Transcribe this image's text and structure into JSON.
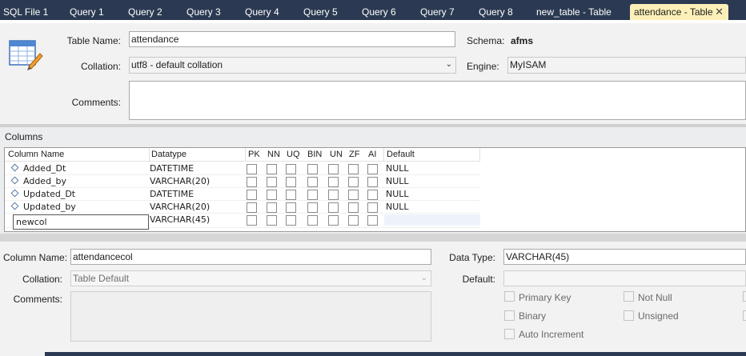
{
  "tabs": [
    {
      "label": "SQL File 1",
      "active": false
    },
    {
      "label": "Query 1",
      "active": false
    },
    {
      "label": "Query 2",
      "active": false
    },
    {
      "label": "Query 3",
      "active": false
    },
    {
      "label": "Query 4",
      "active": false
    },
    {
      "label": "Query 5",
      "active": false
    },
    {
      "label": "Query 6",
      "active": false
    },
    {
      "label": "Query 7",
      "active": false
    },
    {
      "label": "Query 8",
      "active": false
    },
    {
      "label": "new_table - Table",
      "active": false
    },
    {
      "label": "attendance - Table",
      "active": true
    }
  ],
  "close_glyph": "✕",
  "table": {
    "name_label": "Table Name:",
    "name_value": "attendance",
    "schema_label": "Schema:",
    "schema_value": "afms",
    "collation_label": "Collation:",
    "collation_value": "utf8 - default collation",
    "engine_label": "Engine:",
    "engine_value": "MyISAM",
    "comments_label": "Comments:",
    "comments_value": ""
  },
  "columns_section": {
    "title": "Columns",
    "headers": [
      "Column Name",
      "Datatype",
      "PK",
      "NN",
      "UQ",
      "BIN",
      "UN",
      "ZF",
      "AI",
      "Default"
    ],
    "rows": [
      {
        "name": "Added_Dt",
        "datatype": "DATETIME",
        "default": "NULL"
      },
      {
        "name": "Added_by",
        "datatype": "VARCHAR(20)",
        "default": "NULL"
      },
      {
        "name": "Updated_Dt",
        "datatype": "DATETIME",
        "default": "NULL"
      },
      {
        "name": "Updated_by",
        "datatype": "VARCHAR(20)",
        "default": "NULL"
      }
    ],
    "new_row": {
      "name": "newcol",
      "datatype": "VARCHAR(45)",
      "default": ""
    }
  },
  "details": {
    "column_name_label": "Column Name:",
    "column_name_value": "attendancecol",
    "data_type_label": "Data Type:",
    "data_type_value": "VARCHAR(45)",
    "collation_label": "Collation:",
    "collation_value": "Table Default",
    "default_label": "Default:",
    "default_value": "",
    "comments_label": "Comments:",
    "comments_value": "",
    "flags": {
      "primary_key": "Primary Key",
      "not_null": "Not Null",
      "binary": "Binary",
      "unsigned": "Unsigned",
      "auto_increment": "Auto Increment"
    }
  },
  "icons": {
    "table": "table-edit-icon",
    "dropdown": "chevron-down-icon",
    "column": "column-diamond-icon"
  },
  "colors": {
    "tabbar_bg": "#2b3a52",
    "active_tab_bg": "#fcf0b8",
    "panel_bg": "#f2f2f2"
  }
}
